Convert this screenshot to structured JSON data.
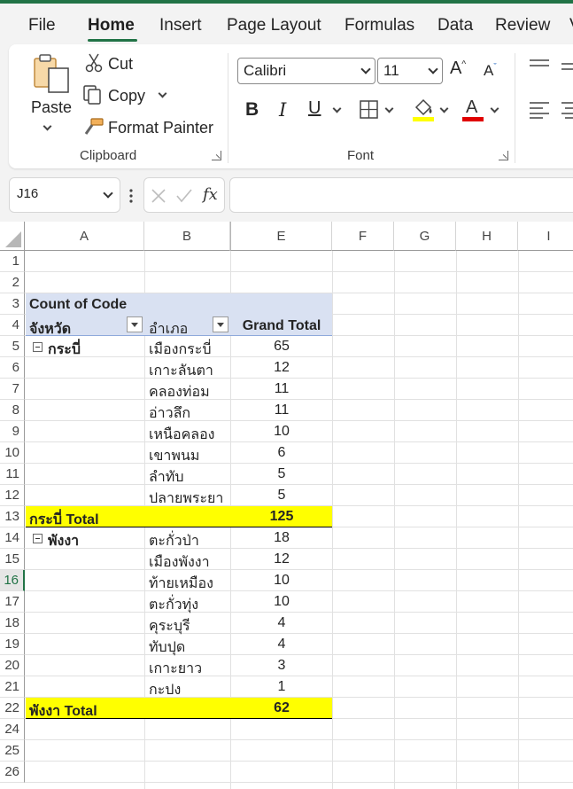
{
  "tabs": [
    "File",
    "Home",
    "Insert",
    "Page Layout",
    "Formulas",
    "Data",
    "Review",
    "V"
  ],
  "ribbon": {
    "clipboard": {
      "paste_label": "Paste",
      "cut_label": "Cut",
      "copy_label": "Copy",
      "format_painter_label": "Format Painter",
      "group_label": "Clipboard"
    },
    "font": {
      "font_name": "Calibri",
      "font_size": "11",
      "group_label": "Font",
      "highlight_color": "#ffff00",
      "font_color": "#ff0000"
    }
  },
  "formula_bar": {
    "name_box": "J16",
    "formula": ""
  },
  "grid": {
    "columns": [
      "A",
      "B",
      "E",
      "F",
      "G",
      "H",
      "I"
    ],
    "rows": [
      "1",
      "2",
      "3",
      "4",
      "5",
      "6",
      "7",
      "8",
      "9",
      "10",
      "11",
      "12",
      "13",
      "14",
      "15",
      "16",
      "17",
      "18",
      "19",
      "20",
      "21",
      "22",
      "24",
      "25",
      "26"
    ],
    "selected_row": "16"
  },
  "pivot": {
    "title": "Count of Code",
    "header_province": "จังหวัด",
    "header_district": "อำเภอ",
    "header_total": "Grand Total",
    "groups": [
      {
        "province": "กระบี่",
        "items": [
          {
            "district": "เมืองกระบี่",
            "count": "65"
          },
          {
            "district": "เกาะลันตา",
            "count": "12"
          },
          {
            "district": "คลองท่อม",
            "count": "11"
          },
          {
            "district": "อ่าวลึก",
            "count": "11"
          },
          {
            "district": "เหนือคลอง",
            "count": "10"
          },
          {
            "district": "เขาพนม",
            "count": "6"
          },
          {
            "district": "ลำทับ",
            "count": "5"
          },
          {
            "district": "ปลายพระยา",
            "count": "5"
          }
        ],
        "total_label": "กระบี่ Total",
        "total": "125"
      },
      {
        "province": "พังงา",
        "items": [
          {
            "district": "ตะกั่วป่า",
            "count": "18"
          },
          {
            "district": "เมืองพังงา",
            "count": "12"
          },
          {
            "district": "ท้ายเหมือง",
            "count": "10"
          },
          {
            "district": "ตะกั่วทุ่ง",
            "count": "10"
          },
          {
            "district": "คุระบุรี",
            "count": "4"
          },
          {
            "district": "ทับปุด",
            "count": "4"
          },
          {
            "district": "เกาะยาว",
            "count": "3"
          },
          {
            "district": "กะปง",
            "count": "1"
          }
        ],
        "total_label": "พังงา Total",
        "total": "62"
      }
    ]
  }
}
